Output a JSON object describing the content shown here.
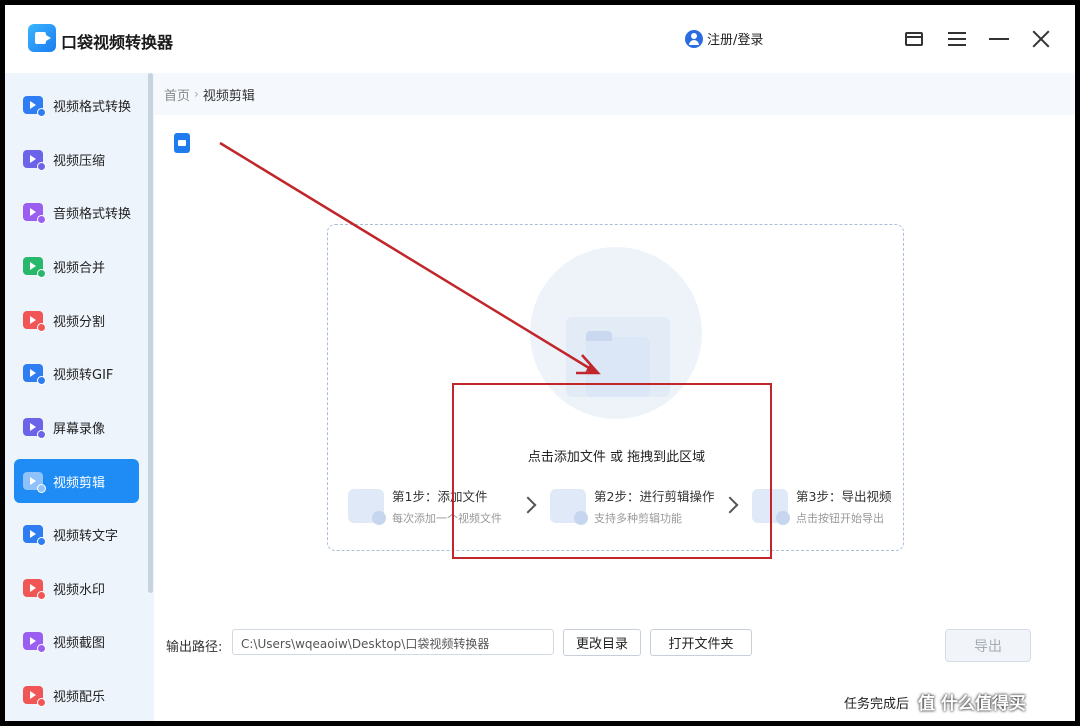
{
  "window": {
    "app_title": "口袋视频转换器",
    "login_label": "注册/登录"
  },
  "sidebar": {
    "items": [
      {
        "label": "视频格式转换",
        "icon": "video-format-icon",
        "color": "#2f7df2",
        "active": false
      },
      {
        "label": "视频压缩",
        "icon": "video-compress-icon",
        "color": "#6b63e8",
        "active": false
      },
      {
        "label": "音频格式转换",
        "icon": "audio-format-icon",
        "color": "#9a5ff0",
        "active": false
      },
      {
        "label": "视频合并",
        "icon": "video-merge-icon",
        "color": "#27b86b",
        "active": false
      },
      {
        "label": "视频分割",
        "icon": "video-split-icon",
        "color": "#f05656",
        "active": false
      },
      {
        "label": "视频转GIF",
        "icon": "video-gif-icon",
        "color": "#2f7df2",
        "active": false
      },
      {
        "label": "屏幕录像",
        "icon": "screen-record-icon",
        "color": "#6b63e8",
        "active": false
      },
      {
        "label": "视频剪辑",
        "icon": "video-edit-icon",
        "color": "#ffffff",
        "active": true
      },
      {
        "label": "视频转文字",
        "icon": "video-text-icon",
        "color": "#2f7df2",
        "active": false
      },
      {
        "label": "视频水印",
        "icon": "video-watermark-icon",
        "color": "#f05656",
        "active": false
      },
      {
        "label": "视频截图",
        "icon": "video-screenshot-icon",
        "color": "#9a5ff0",
        "active": false
      },
      {
        "label": "视频配乐",
        "icon": "video-music-icon",
        "color": "#f05656",
        "active": false
      }
    ]
  },
  "breadcrumb": {
    "home": "首页",
    "separator": "›",
    "current": "视频剪辑"
  },
  "dropzone": {
    "prompt": "点击添加文件 或 拖拽到此区域",
    "steps": [
      {
        "title": "第1步：添加文件",
        "subtitle": "每次添加一个视频文件"
      },
      {
        "title": "第2步：进行剪辑操作",
        "subtitle": "支持多种剪辑功能"
      },
      {
        "title": "第3步：导出视频",
        "subtitle": "点击按钮开始导出"
      }
    ]
  },
  "output": {
    "label": "输出路径:",
    "path": "C:\\Users\\wqeaoiw\\Desktop\\口袋视频转换器",
    "change_dir": "更改目录",
    "open_folder": "打开文件夹",
    "export": "导出"
  },
  "footer": {
    "task_done": "任务完成后",
    "watermark": "值 什么值得买"
  },
  "colors": {
    "accent": "#1f8cf5",
    "annotation": "#c0262a"
  }
}
